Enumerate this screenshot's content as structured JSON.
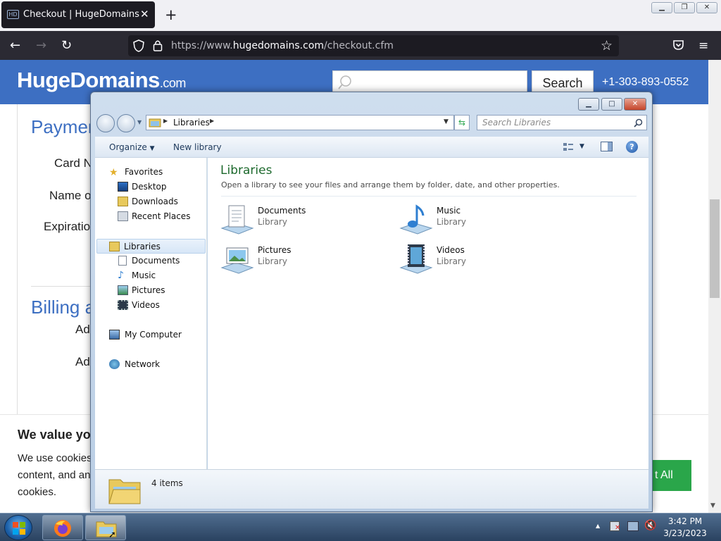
{
  "browser": {
    "tab_title": "Checkout | HugeDomains",
    "tab_favicon": "HD",
    "url_prefix": "https://www.",
    "url_domain": "hugedomains.com",
    "url_path": "/checkout.cfm"
  },
  "site": {
    "logo_main": "HugeDomains",
    "logo_suffix": ".com",
    "search_button": "Search",
    "phone": "+1-303-893-0552",
    "section_payment": "Paymen",
    "label_card": "Card N",
    "label_name": "Name o",
    "label_expiration": "Expiratio",
    "section_billing": "Billing a",
    "label_addr1": "Ad",
    "label_addr2": "Ad",
    "edge_char": "t",
    "cookie_title": "We value yo",
    "cookie_line1": "We use cookies",
    "cookie_line2": "content, and an",
    "cookie_line3": "cookies.",
    "accept_button": "t All"
  },
  "explorer": {
    "address_crumb": "Libraries",
    "search_placeholder": "Search Libraries",
    "toolbar": {
      "organize": "Organize",
      "new_library": "New library"
    },
    "nav": {
      "favorites": "Favorites",
      "favorites_items": [
        "Desktop",
        "Downloads",
        "Recent Places"
      ],
      "libraries": "Libraries",
      "libraries_items": [
        "Documents",
        "Music",
        "Pictures",
        "Videos"
      ],
      "computer": "My Computer",
      "network": "Network"
    },
    "heading": "Libraries",
    "description": "Open a library to see your files and arrange them by folder, date, and other properties.",
    "libraries": [
      {
        "name": "Documents",
        "type": "Library"
      },
      {
        "name": "Music",
        "type": "Library"
      },
      {
        "name": "Pictures",
        "type": "Library"
      },
      {
        "name": "Videos",
        "type": "Library"
      }
    ],
    "status_count": "4 items"
  },
  "taskbar": {
    "time": "3:42 PM",
    "date": "3/23/2023"
  }
}
